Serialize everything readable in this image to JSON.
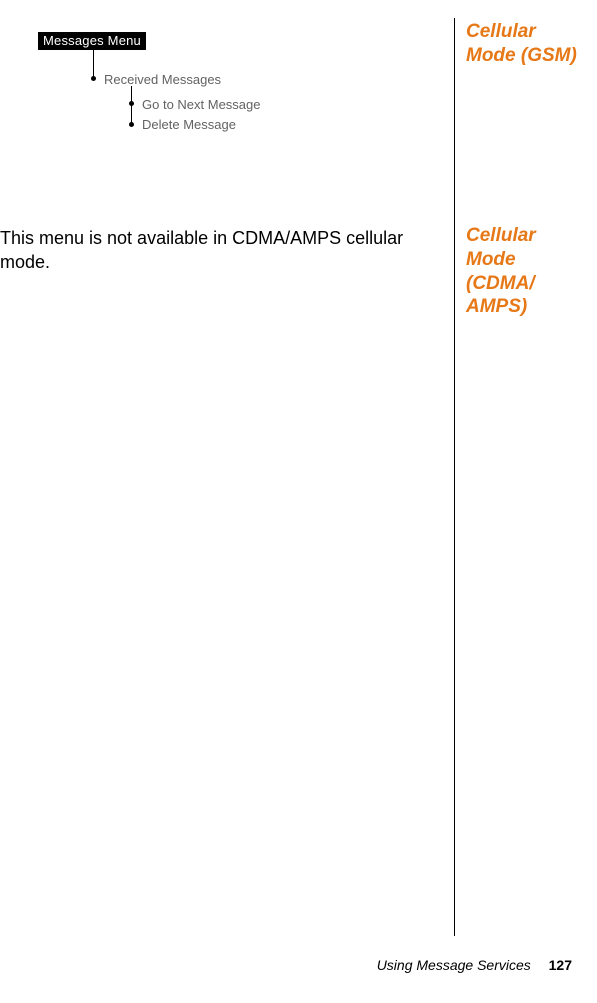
{
  "sidebar": {
    "gsm": "Cellular Mode (GSM)",
    "cdma": "Cellular Mode (CDMA/ AMPS)"
  },
  "menu": {
    "root": "Messages Menu",
    "level1": "Received Messages",
    "level2a": "Go to Next Message",
    "level2b": "Delete Message"
  },
  "body": "This menu is not available in CDMA/AMPS cellular mode.",
  "footer": {
    "section": "Using Message Services",
    "page": "127"
  }
}
